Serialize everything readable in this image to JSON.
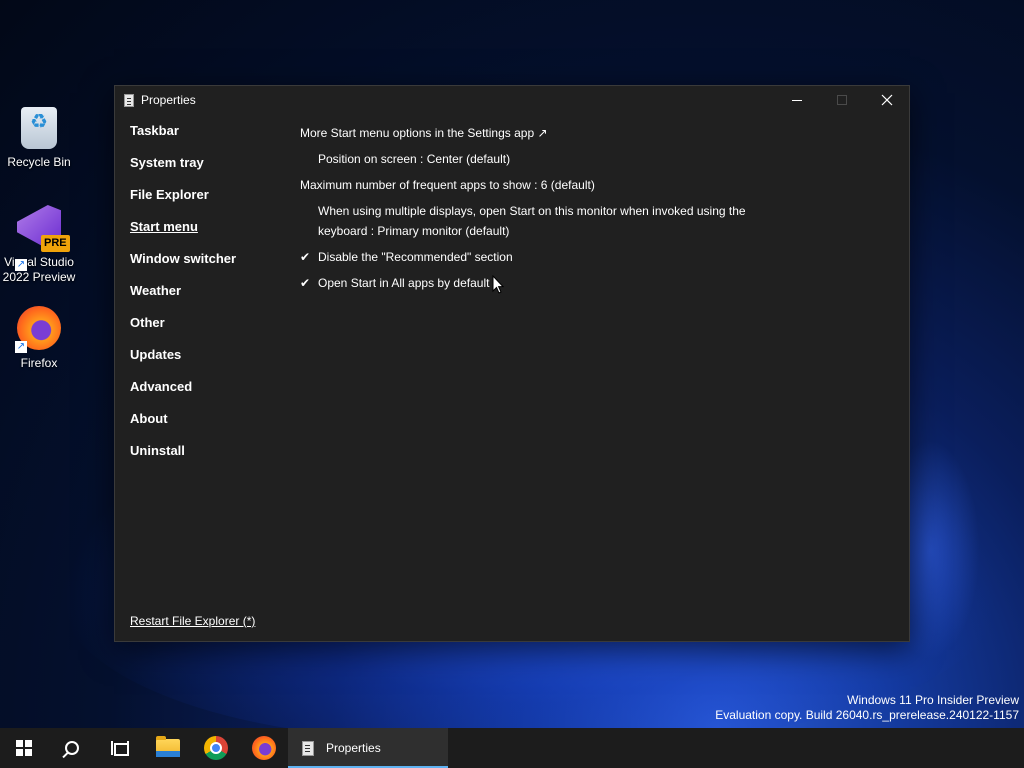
{
  "desktop": {
    "icons": [
      {
        "label": "Recycle Bin",
        "icon": "recycle-bin-icon"
      },
      {
        "label": "Visual Studio 2022 Preview",
        "badge": "PRE",
        "icon": "visual-studio-icon"
      },
      {
        "label": "Firefox",
        "icon": "firefox-icon"
      }
    ],
    "watermark": {
      "line1": "Windows 11 Pro Insider Preview",
      "line2": "Evaluation copy. Build 26040.rs_prerelease.240122-1157"
    }
  },
  "window": {
    "title": "Properties",
    "caption": {
      "minimize": "–",
      "maximize": "□",
      "close": "✕"
    }
  },
  "sidebar": {
    "items": [
      {
        "label": "Taskbar"
      },
      {
        "label": "System tray"
      },
      {
        "label": "File Explorer"
      },
      {
        "label": "Start menu",
        "active": true
      },
      {
        "label": "Window switcher"
      },
      {
        "label": "Weather"
      },
      {
        "label": "Other"
      },
      {
        "label": "Updates"
      },
      {
        "label": "Advanced"
      },
      {
        "label": "About"
      },
      {
        "label": "Uninstall"
      }
    ],
    "restart_label": "Restart File Explorer (*)"
  },
  "content": {
    "options": [
      {
        "text": "More Start menu options in the Settings app ↗",
        "checked": false,
        "indent": false
      },
      {
        "text": "Position on screen : Center (default)",
        "checked": false,
        "indent": true
      },
      {
        "text": "Maximum number of frequent apps to show : 6 (default)",
        "checked": false,
        "indent": false
      },
      {
        "text": "When using multiple displays, open Start on this monitor when invoked using the keyboard : Primary monitor (default)",
        "checked": false,
        "indent": true
      },
      {
        "text": "Disable the \"Recommended\" section",
        "checked": true,
        "indent": true
      },
      {
        "text": "Open Start in All apps by default",
        "checked": true,
        "indent": true
      }
    ],
    "check_glyph": "✔"
  },
  "taskbar": {
    "buttons": [
      {
        "name": "start",
        "icon": "windows-logo-icon"
      },
      {
        "name": "search",
        "icon": "search-icon"
      },
      {
        "name": "task-view",
        "icon": "task-view-icon"
      },
      {
        "name": "file-explorer",
        "icon": "folder-icon"
      },
      {
        "name": "chrome",
        "icon": "chrome-icon"
      },
      {
        "name": "firefox",
        "icon": "firefox-icon"
      }
    ],
    "active_app": {
      "label": "Properties",
      "icon": "properties-icon"
    }
  },
  "colors": {
    "window_bg": "#202020",
    "taskbar_bg": "#1c1c1c",
    "accent": "#5fb2f2"
  }
}
